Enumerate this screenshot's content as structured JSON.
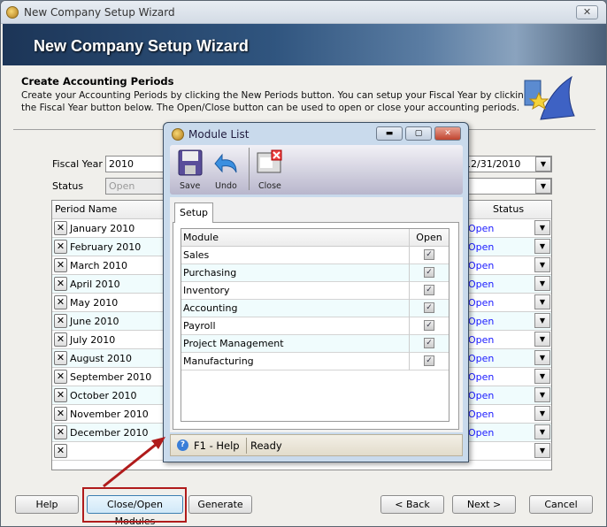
{
  "window": {
    "title": "New Company Setup Wizard",
    "banner_title": "New Company Setup Wizard",
    "close_glyph": "✕"
  },
  "intro": {
    "heading": "Create Accounting Periods",
    "line1": "Create your Accounting Periods by clicking the New Periods button. You can setup your Fiscal Year by clicking",
    "line2": "the Fiscal Year button below. The Open/Close button can be used to open or close your accounting periods."
  },
  "form": {
    "fiscal_year_label": "Fiscal Year",
    "fiscal_year_value": "2010",
    "end_date_value": "12/31/2010",
    "status_label": "Status",
    "status_value": "Open"
  },
  "grid": {
    "col_period": "Period Name",
    "col_status": "Status",
    "rows": [
      {
        "name": "January 2010",
        "status": "Open"
      },
      {
        "name": "February 2010",
        "status": "Open"
      },
      {
        "name": "March 2010",
        "status": "Open"
      },
      {
        "name": "April 2010",
        "status": "Open"
      },
      {
        "name": "May 2010",
        "status": "Open"
      },
      {
        "name": "June 2010",
        "status": "Open"
      },
      {
        "name": "July 2010",
        "status": "Open"
      },
      {
        "name": "August 2010",
        "status": "Open"
      },
      {
        "name": "September 2010",
        "status": "Open"
      },
      {
        "name": "October 2010",
        "status": "Open"
      },
      {
        "name": "November 2010",
        "status": "Open"
      },
      {
        "name": "December 2010",
        "status": "Open"
      },
      {
        "name": "",
        "status": ""
      }
    ]
  },
  "dialog": {
    "title": "Module List",
    "toolbar": {
      "save": "Save",
      "undo": "Undo",
      "close": "Close"
    },
    "tab": "Setup",
    "col_module": "Module",
    "col_open": "Open",
    "modules": [
      {
        "name": "Sales",
        "open": true
      },
      {
        "name": "Purchasing",
        "open": true
      },
      {
        "name": "Inventory",
        "open": true
      },
      {
        "name": "Accounting",
        "open": true
      },
      {
        "name": "Payroll",
        "open": true
      },
      {
        "name": "Project Management",
        "open": true
      },
      {
        "name": "Manufacturing",
        "open": true
      }
    ],
    "status_help": "F1 - Help",
    "status_text": "Ready"
  },
  "buttons": {
    "help": "Help",
    "close_open_modules": "Close/Open Modules",
    "generate": "Generate",
    "back": "< Back",
    "next": "Next >",
    "cancel": "Cancel"
  },
  "colors": {
    "highlight": "#b01b1b",
    "status_open": "#1a1aff"
  }
}
